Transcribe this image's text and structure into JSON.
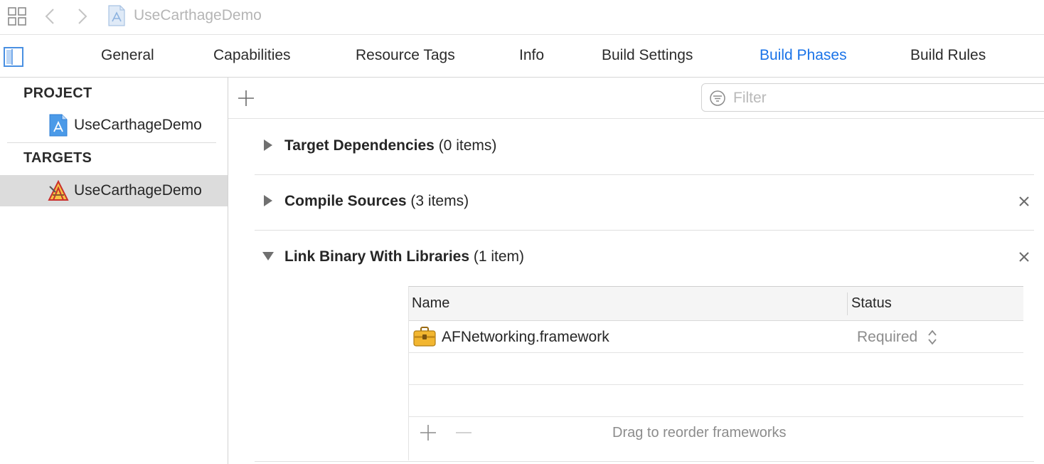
{
  "jumpbar": {
    "crumb": "UseCarthageDemo",
    "icons": [
      "related-items-grid-icon",
      "back-chevron-icon",
      "forward-chevron-icon",
      "project-file-icon"
    ]
  },
  "tabs": [
    {
      "label": "General",
      "active": false
    },
    {
      "label": "Capabilities",
      "active": false
    },
    {
      "label": "Resource Tags",
      "active": false
    },
    {
      "label": "Info",
      "active": false
    },
    {
      "label": "Build Settings",
      "active": false
    },
    {
      "label": "Build Phases",
      "active": true
    },
    {
      "label": "Build Rules",
      "active": false
    }
  ],
  "sidebar": {
    "project_header": "PROJECT",
    "project_item": "UseCarthageDemo",
    "targets_header": "TARGETS",
    "target_item": "UseCarthageDemo"
  },
  "filter": {
    "placeholder": "Filter",
    "value": ""
  },
  "phases": {
    "target_dependencies": {
      "title": "Target Dependencies",
      "count": "(0 items)"
    },
    "compile_sources": {
      "title": "Compile Sources",
      "count": "(3 items)"
    },
    "link_binary": {
      "title": "Link Binary With Libraries",
      "count": "(1 item)"
    }
  },
  "libraries": {
    "columns": {
      "name": "Name",
      "status": "Status"
    },
    "rows": [
      {
        "name": "AFNetworking.framework",
        "status": "Required"
      }
    ],
    "footer_hint": "Drag to reorder frameworks"
  },
  "colors": {
    "accent": "#1a73e8",
    "selected_row": "#dcdcdc",
    "muted_text": "#8c8c8c"
  }
}
